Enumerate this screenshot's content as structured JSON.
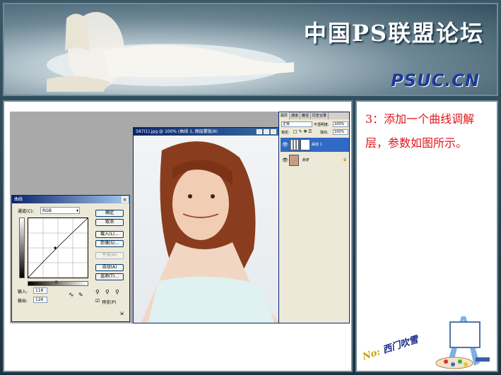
{
  "banner": {
    "title": "中国PS联盟论坛",
    "logo": "PSUC.CN"
  },
  "tutorial": {
    "step_text": "3：添加一个曲线调解层，参数如图所示。",
    "signature": "No:",
    "signature_name": "西门吹雪"
  },
  "curves_dialog": {
    "title": "曲线",
    "channel_label": "通道(C):",
    "channel_value": "RGB",
    "buttons": [
      "确定",
      "取消",
      "载入(L)...",
      "存储(S)...",
      "平滑(M)",
      "自动(A)",
      "选项(T)..."
    ],
    "input_label": "输入:",
    "input_value": "116",
    "output_label": "输出:",
    "output_value": "126",
    "preview_label": "预览(P)",
    "preview_checked": true
  },
  "photo_window": {
    "title": "587(1).jpg @ 100% (曲线 1, 图层蒙版/8)"
  },
  "layers_panel": {
    "tabs": [
      "图层",
      "通道",
      "路径",
      "历史记录"
    ],
    "blend_mode": "正常",
    "opacity_label": "不透明度:",
    "opacity_value": "100%",
    "lock_label": "锁定:",
    "fill_label": "填充:",
    "fill_value": "100%",
    "layers": [
      {
        "name": "曲线 1",
        "selected": true
      },
      {
        "name": "背景",
        "selected": false
      }
    ]
  }
}
